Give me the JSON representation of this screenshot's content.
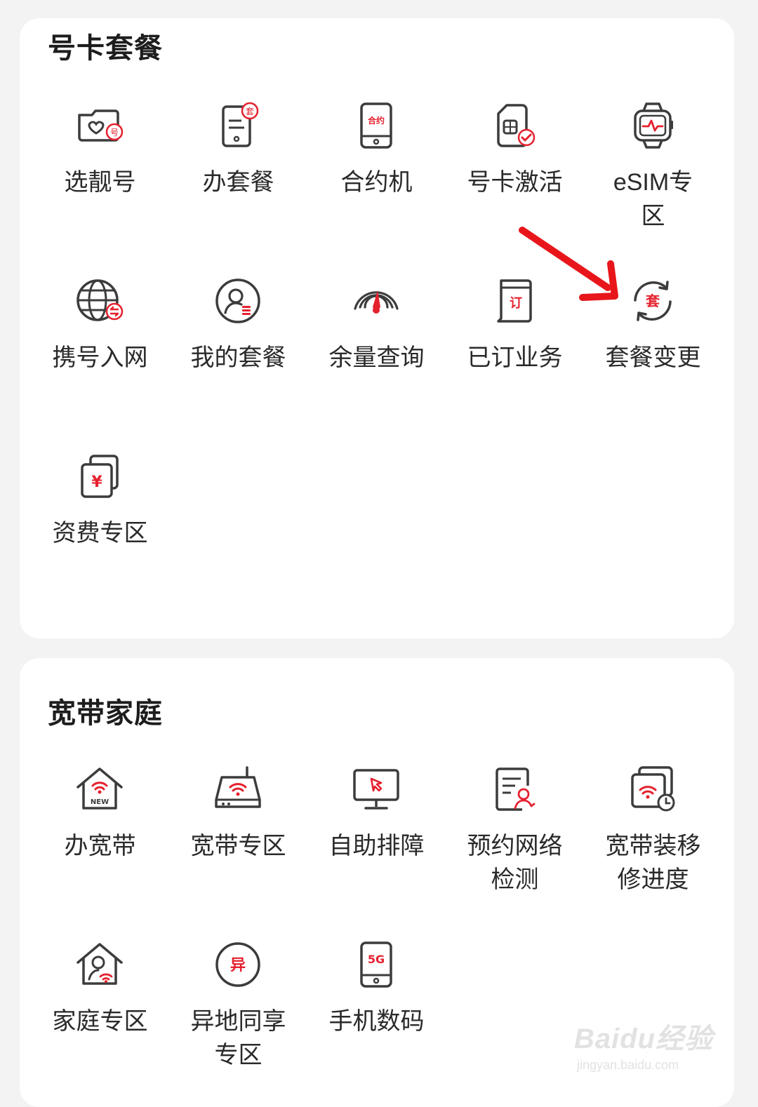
{
  "colors": {
    "accent": "#e5212e",
    "icon_stroke": "#3c3c3c",
    "card_bg": "#ffffff",
    "page_bg": "#f3f3f4",
    "annotation_arrow": "#e8161b"
  },
  "sections": [
    {
      "title": "号卡套餐",
      "items": [
        {
          "label": "选靓号",
          "icon": "folder-heart-icon",
          "icon_text": "号"
        },
        {
          "label": "办套餐",
          "icon": "document-badge-icon",
          "icon_text": "套"
        },
        {
          "label": "合约机",
          "icon": "contract-phone-icon",
          "icon_text": "合约"
        },
        {
          "label": "号卡激活",
          "icon": "sim-check-icon"
        },
        {
          "label": "eSIM专区",
          "icon": "smartwatch-icon"
        },
        {
          "label": "携号入网",
          "icon": "globe-transfer-icon"
        },
        {
          "label": "我的套餐",
          "icon": "user-plan-icon"
        },
        {
          "label": "余量查询",
          "icon": "signal-gauge-icon"
        },
        {
          "label": "已订业务",
          "icon": "subscribed-service-icon",
          "icon_text": "订"
        },
        {
          "label": "套餐变更",
          "icon": "plan-change-icon",
          "icon_text": "套"
        },
        {
          "label": "资费专区",
          "icon": "tariff-cards-icon",
          "icon_text": "¥"
        }
      ]
    },
    {
      "title": "宽带家庭",
      "items": [
        {
          "label": "办宽带",
          "icon": "home-wifi-new-icon",
          "icon_text": "NEW"
        },
        {
          "label": "宽带专区",
          "icon": "router-icon"
        },
        {
          "label": "自助排障",
          "icon": "monitor-cursor-icon"
        },
        {
          "label": "预约网络检测",
          "icon": "document-inspect-icon"
        },
        {
          "label": "宽带装移修进度",
          "icon": "wifi-clock-icon"
        },
        {
          "label": "家庭专区",
          "icon": "home-user-icon"
        },
        {
          "label": "异地同享专区",
          "icon": "remote-share-icon",
          "icon_text": "异"
        },
        {
          "label": "手机数码",
          "icon": "phone-5g-icon",
          "icon_text": "5G"
        }
      ]
    }
  ],
  "watermark": {
    "brand": "Baidu经验",
    "url": "jingyan.baidu.com"
  }
}
